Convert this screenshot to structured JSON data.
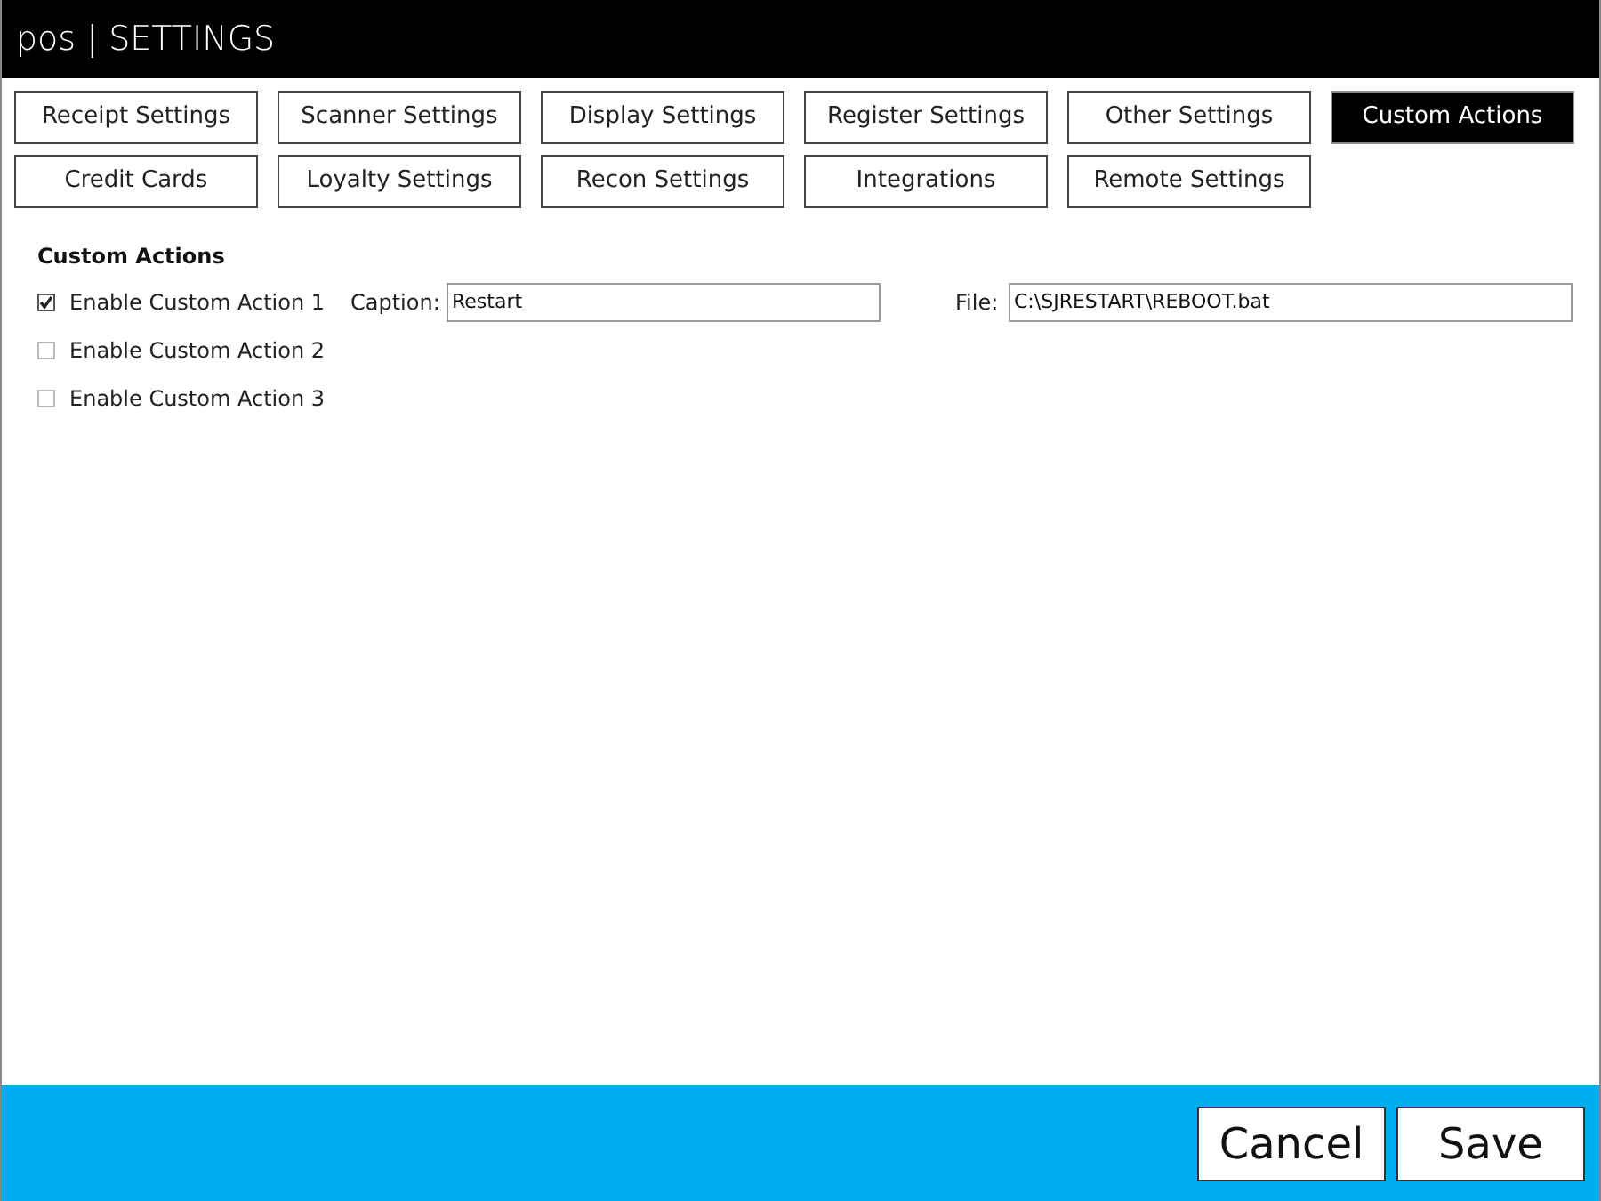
{
  "window": {
    "title": "pos | SETTINGS"
  },
  "tabs": [
    {
      "label": "Receipt Settings",
      "selected": false
    },
    {
      "label": "Scanner Settings",
      "selected": false
    },
    {
      "label": "Display Settings",
      "selected": false
    },
    {
      "label": "Register Settings",
      "selected": false
    },
    {
      "label": "Other Settings",
      "selected": false
    },
    {
      "label": "Custom Actions",
      "selected": true
    },
    {
      "label": "Credit Cards",
      "selected": false
    },
    {
      "label": "Loyalty Settings",
      "selected": false
    },
    {
      "label": "Recon Settings",
      "selected": false
    },
    {
      "label": "Integrations",
      "selected": false
    },
    {
      "label": "Remote Settings",
      "selected": false
    }
  ],
  "section": {
    "heading": "Custom Actions",
    "actions": [
      {
        "label": "Enable Custom Action 1",
        "checked": true,
        "caption_label": "Caption:",
        "caption": "Restart",
        "file_label": "File:",
        "file": "C:\\SJRESTART\\REBOOT.bat"
      },
      {
        "label": "Enable Custom Action 2",
        "checked": false
      },
      {
        "label": "Enable Custom Action 3",
        "checked": false
      }
    ]
  },
  "buttons": [
    "Cancel",
    "Save"
  ]
}
